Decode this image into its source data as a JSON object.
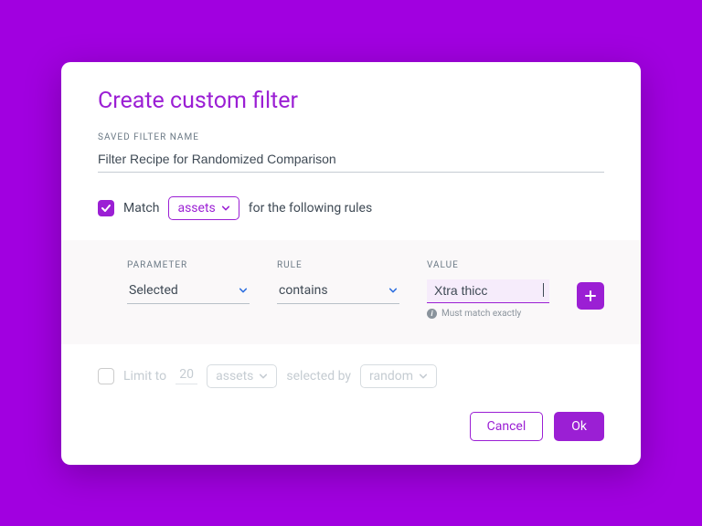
{
  "title": "Create custom filter",
  "name_field": {
    "label": "SAVED FILTER NAME",
    "value": "Filter Recipe for Randomized Comparison"
  },
  "match": {
    "checked": true,
    "pre": "Match",
    "target": "assets",
    "post": "for the following rules"
  },
  "rules": {
    "headers": {
      "parameter": "PARAMETER",
      "rule": "RULE",
      "value": "VALUE"
    },
    "row": {
      "parameter": "Selected",
      "rule": "contains",
      "value": "Xtra thicc"
    },
    "hint": "Must match exactly"
  },
  "limit": {
    "checked": false,
    "pre": "Limit to",
    "count": "20",
    "unit": "assets",
    "mid": "selected by",
    "method": "random"
  },
  "footer": {
    "cancel": "Cancel",
    "ok": "Ok"
  }
}
